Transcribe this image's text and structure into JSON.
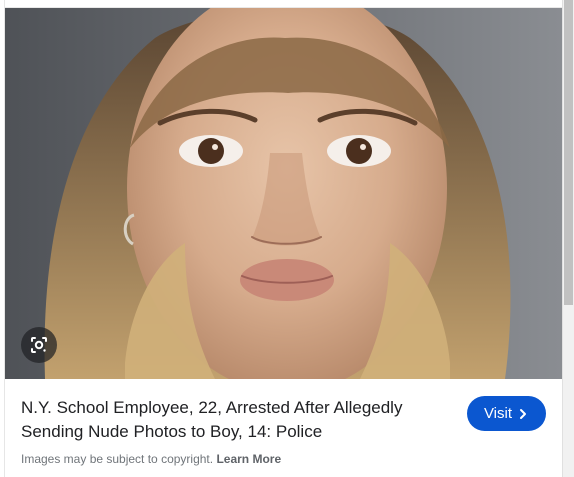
{
  "preview": {
    "image_alt": "Image preview",
    "lens_icon": "google-lens-icon",
    "caption": "N.Y. School Employee, 22, Arrested After Allegedly Sending Nude Photos to Boy, 14: Police",
    "visit_label": "Visit",
    "visit_icon": "chevron-right-icon",
    "copyright_text": "Images may be subject to copyright.",
    "learn_more_label": "Learn More",
    "accent_color": "#0b57d0"
  }
}
